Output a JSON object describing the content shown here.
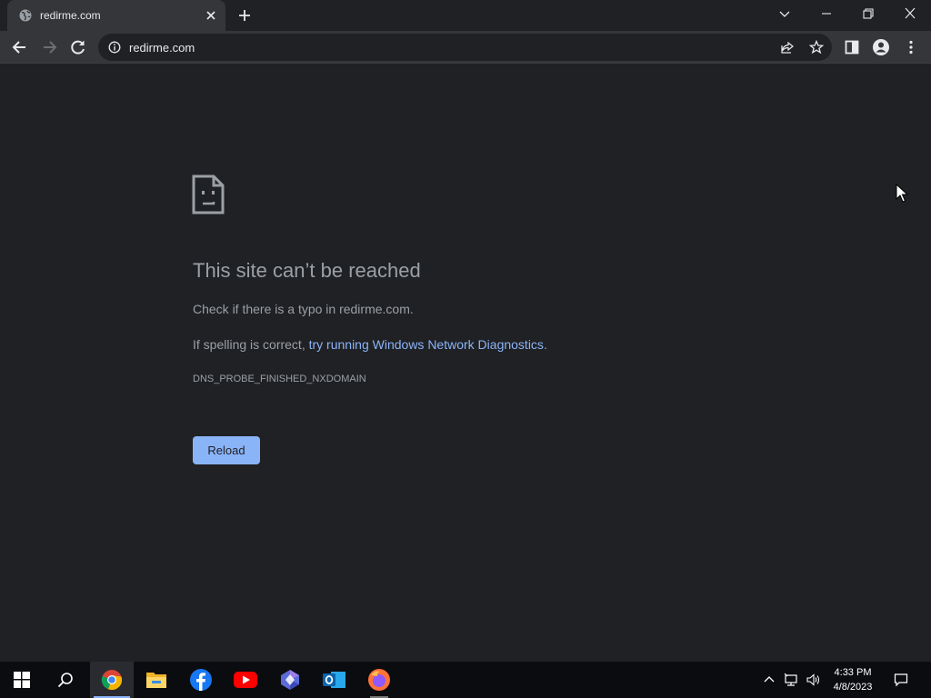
{
  "browser": {
    "tab": {
      "title": "redirme.com"
    },
    "address_bar": {
      "url": "redirme.com"
    }
  },
  "error_page": {
    "heading": "This site can’t be reached",
    "line1": "Check if there is a typo in redirme.com.",
    "line2_prefix": "If spelling is correct, ",
    "line2_link": "try running Windows Network Diagnostics",
    "line2_suffix": ".",
    "error_code": "DNS_PROBE_FINISHED_NXDOMAIN",
    "reload_label": "Reload"
  },
  "taskbar": {
    "apps": [
      "start-icon",
      "search-icon",
      "chrome-icon",
      "file-explorer-icon",
      "facebook-icon",
      "youtube-icon",
      "copilot-icon",
      "outlook-icon",
      "firefox-icon"
    ],
    "clock_time": "4:33 PM",
    "clock_date": "4/8/2023"
  },
  "colors": {
    "background": "#202124",
    "toolbar": "#35363a",
    "link": "#8ab4f8",
    "text": "#9aa0a6",
    "taskbar": "#0b0c0f"
  }
}
